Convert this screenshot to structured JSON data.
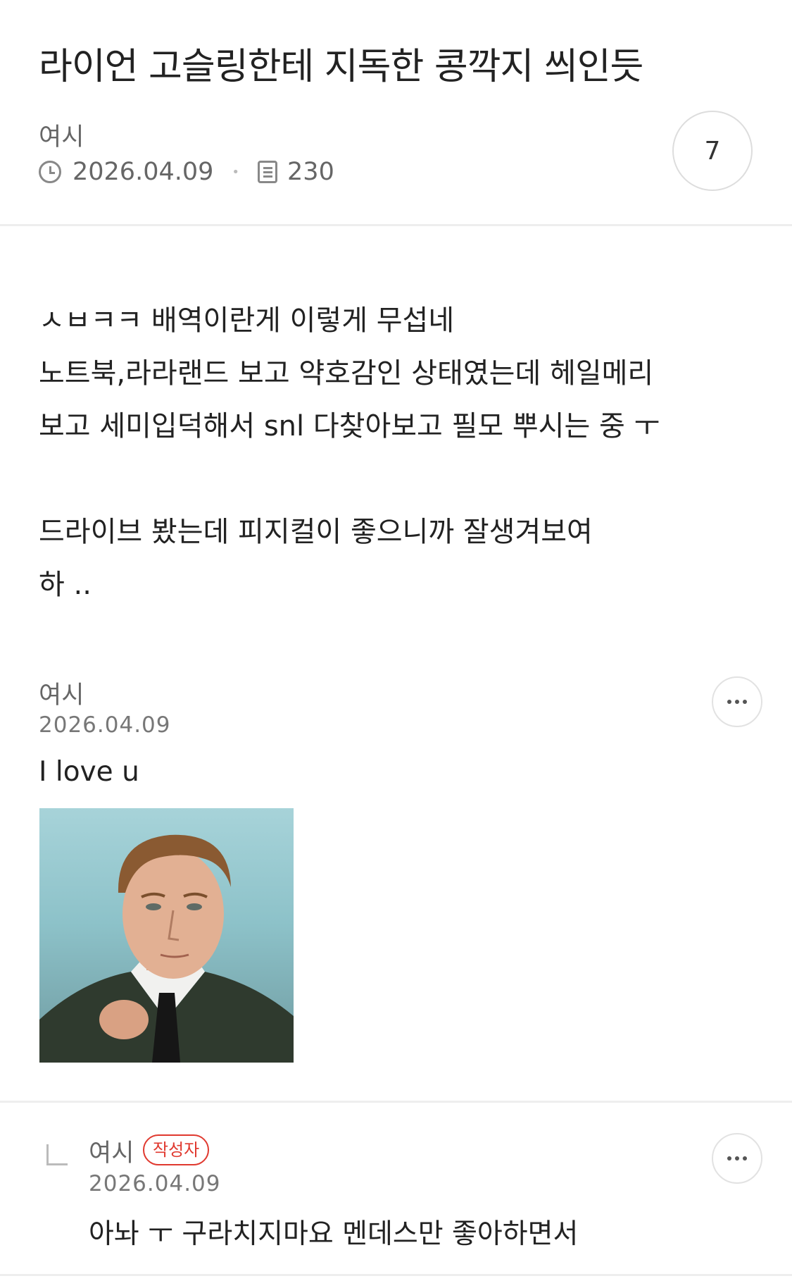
{
  "post": {
    "title": "라이언 고슬링한테 지독한 콩깍지 씌인듯",
    "author": "여시",
    "date": "2026.04.09",
    "views": "230",
    "comment_count": "7",
    "body": "ㅅㅂㅋㅋ 배역이란게 이렇게 무섭네\n노트북,라라랜드 보고 약호감인 상태였는데 헤일메리\n보고 세미입덕해서 snl 다찾아보고 필모 뿌시는 중 ㅜ\n\n드라이브 봤는데 피지컬이 좋으니까 잘생겨보여\n하 .."
  },
  "comments": [
    {
      "author": "여시",
      "date": "2026.04.09",
      "text": "I love u",
      "has_image": true
    },
    {
      "author": "여시",
      "badge": "작성자",
      "date": "2026.04.09",
      "text": "아놔 ㅜ 구라치지마요 멘데스만 좋아하면서",
      "is_reply": true
    }
  ],
  "icons": {
    "clock": "clock-icon",
    "views": "document-icon",
    "more": "more-icon",
    "reply": "reply-arrow-icon"
  },
  "colors": {
    "badge": "#e0392f",
    "divider": "#eeeeee",
    "meta_text": "#666666"
  }
}
